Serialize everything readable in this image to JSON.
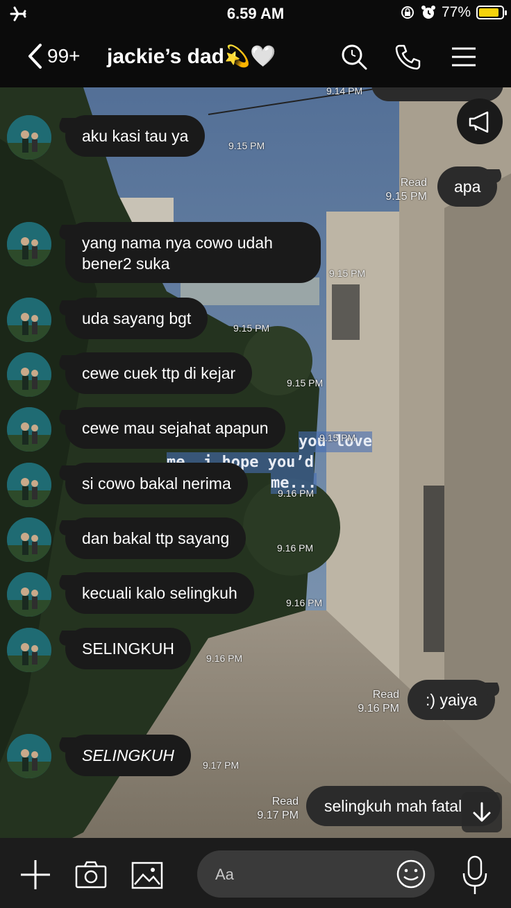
{
  "status_bar": {
    "time": "6.59 AM",
    "battery": "77%",
    "battery_level": 0.77,
    "icons": [
      "airplane-icon",
      "rotation-lock-icon",
      "alarm-icon",
      "battery-icon"
    ]
  },
  "header": {
    "back_count": "99+",
    "title": "jackie’s dad💫🤍",
    "icons": [
      "search-icon",
      "phone-icon",
      "menu-icon"
    ]
  },
  "messages": [
    {
      "id": "m0",
      "side": "in",
      "time": "9.14 PM"
    },
    {
      "id": "m1",
      "side": "in",
      "text": "aku kasi tau ya",
      "time": "9.15 PM"
    },
    {
      "id": "m2",
      "side": "out",
      "text": "apa",
      "read": "Read",
      "time": "9.15 PM"
    },
    {
      "id": "m3",
      "side": "in",
      "line1": "yang nama nya cowo udah",
      "line2": "bener2 suka",
      "time": "9.15 PM"
    },
    {
      "id": "m4",
      "side": "in",
      "text": "uda sayang bgt",
      "time": "9.15 PM"
    },
    {
      "id": "m5",
      "side": "in",
      "text": "cewe cuek ttp di kejar",
      "time": "9.15 PM"
    },
    {
      "id": "m6",
      "side": "in",
      "text": "cewe mau sejahat apapun",
      "time": "9.15 PM"
    },
    {
      "id": "m7",
      "side": "in",
      "text": "si cowo bakal nerima",
      "time": "9.16 PM"
    },
    {
      "id": "m8",
      "side": "in",
      "text": "dan bakal ttp sayang",
      "time": "9.16 PM"
    },
    {
      "id": "m9",
      "side": "in",
      "text": "kecuali kalo selingkuh",
      "time": "9.16 PM"
    },
    {
      "id": "m10",
      "side": "in",
      "text": "SELINGKUH",
      "time": "9.16 PM"
    },
    {
      "id": "m11",
      "side": "out",
      "text": ":) yaiya",
      "read": "Read",
      "time": "9.16 PM"
    },
    {
      "id": "m12",
      "side": "in",
      "text": "SELINGKUH",
      "time": "9.17 PM",
      "italic": true
    },
    {
      "id": "m13",
      "side": "out",
      "text": "selingkuh mah fatal",
      "read": "Read",
      "time": "9.17 PM"
    }
  ],
  "wallpaper_text": {
    "line1": "you love",
    "line2": "me, i hope you’d",
    "line3": "me..."
  },
  "composer": {
    "placeholder": "Aa"
  },
  "bottom_icons": [
    "plus-icon",
    "camera-icon",
    "image-icon",
    "emoji-icon",
    "microphone-icon"
  ],
  "floating": [
    "announcement-icon",
    "scroll-down-icon"
  ],
  "colors": {
    "bubble": "#1a1a1a",
    "battery": "#f5d20c",
    "bar": "#1c1c1c"
  }
}
